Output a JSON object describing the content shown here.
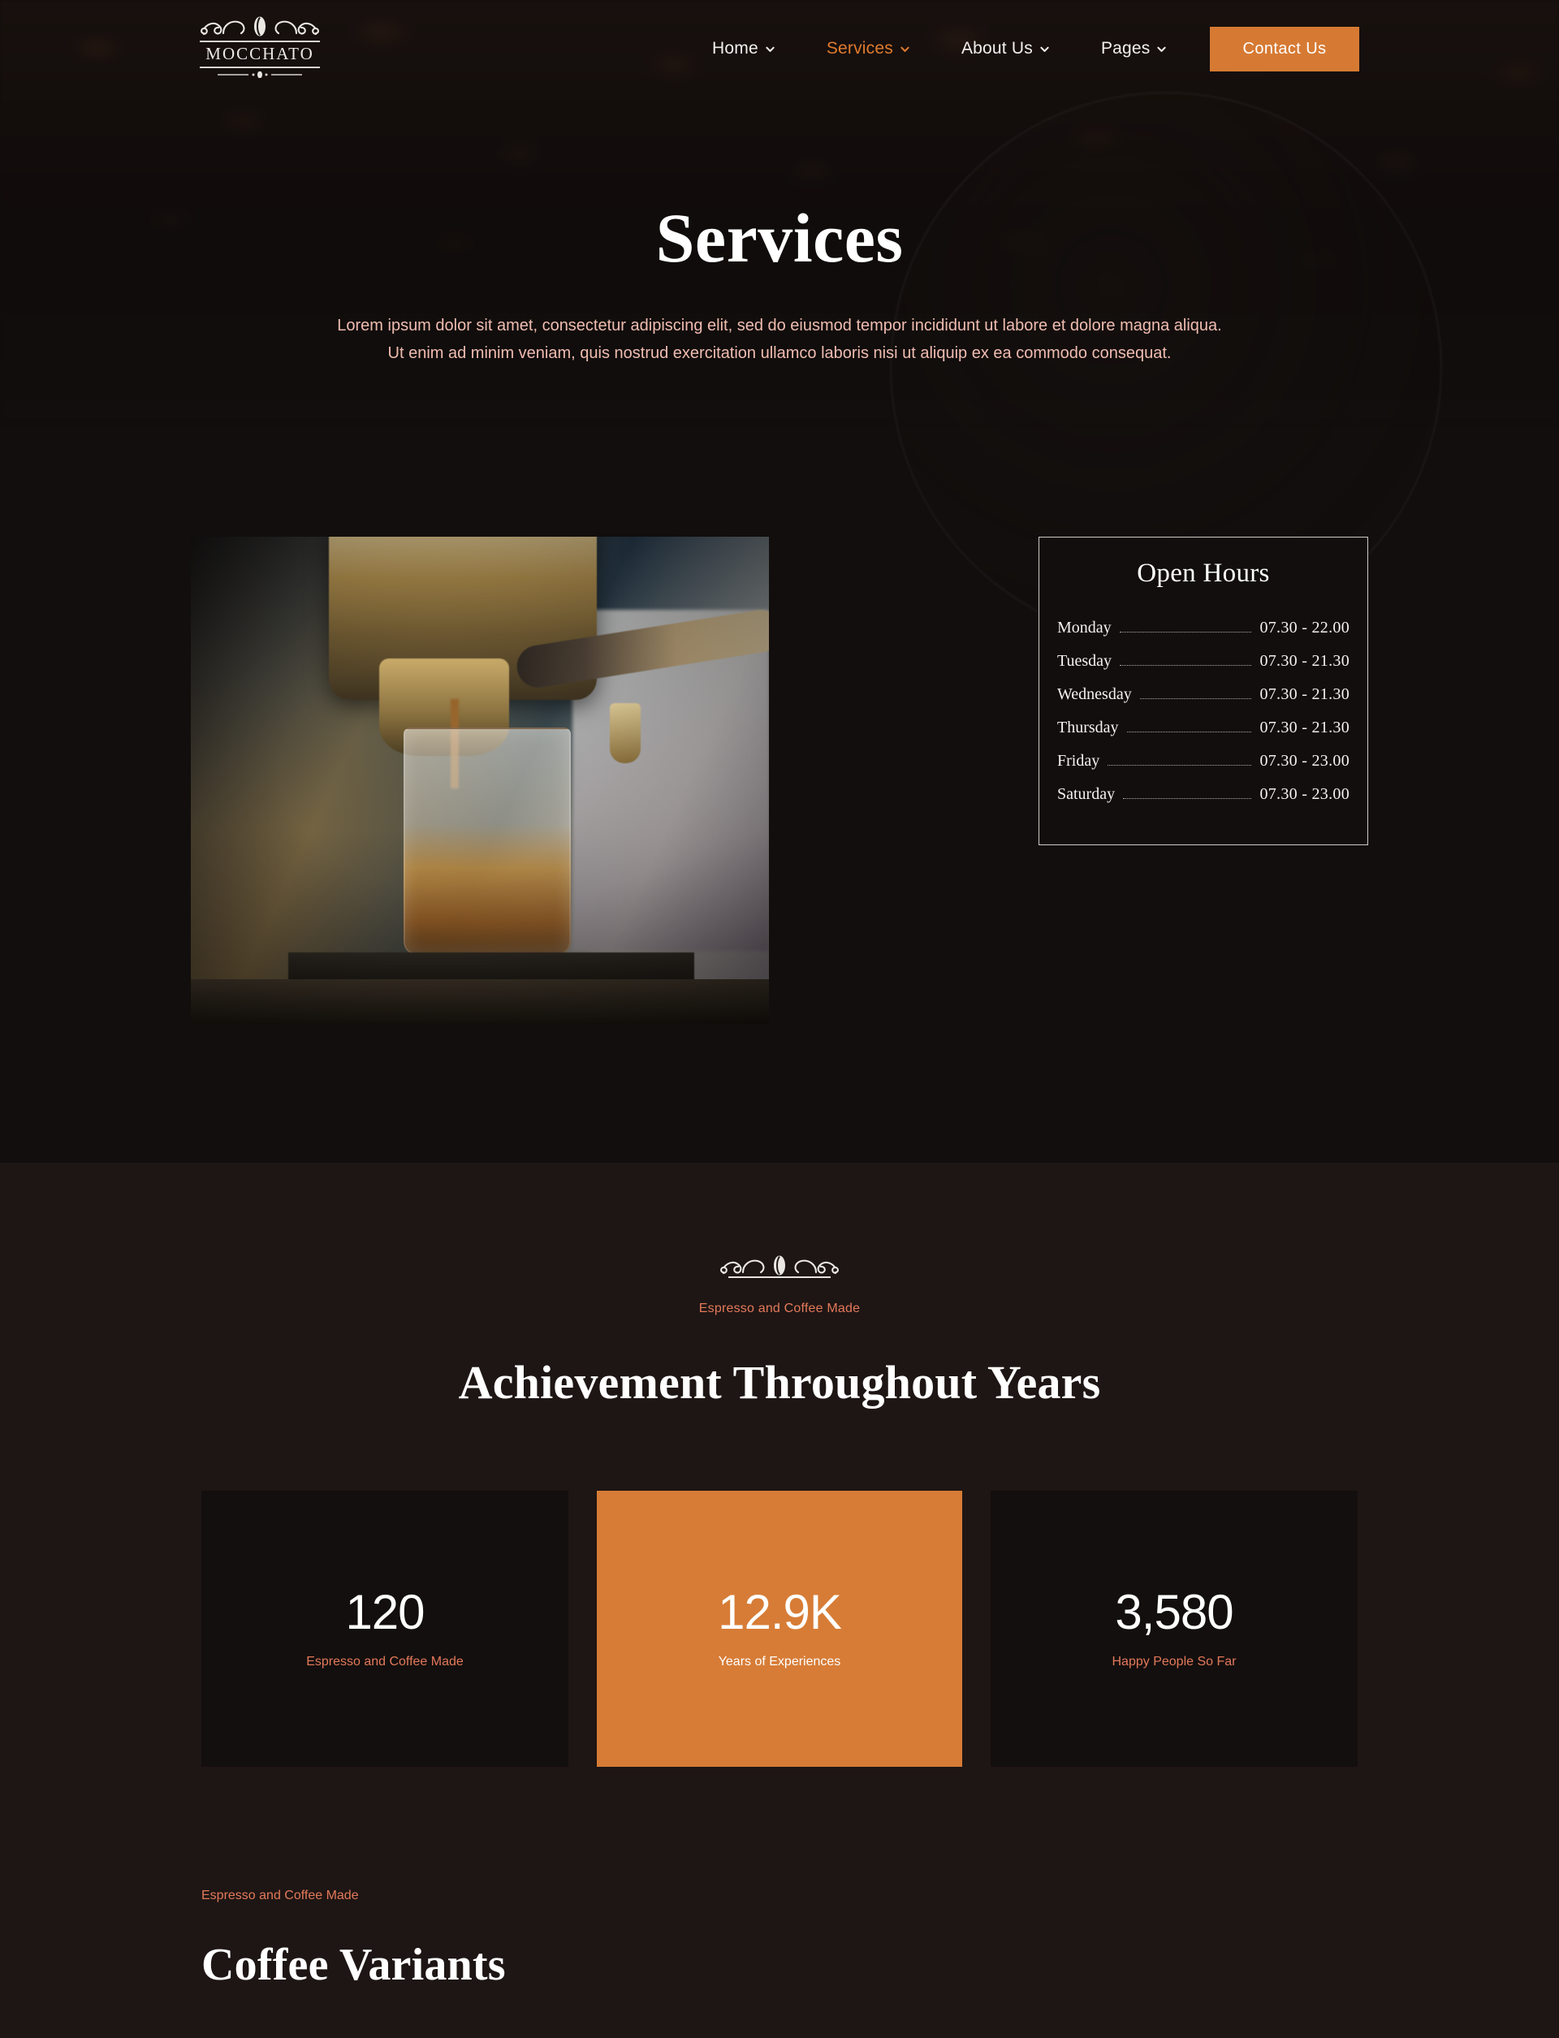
{
  "brand": {
    "name": "MOCCHATO",
    "logo_icon": "coffee-bean-ornament-icon"
  },
  "nav": {
    "items": [
      {
        "label": "Home",
        "has_dropdown": true,
        "active": false
      },
      {
        "label": "Services",
        "has_dropdown": true,
        "active": true
      },
      {
        "label": "About Us",
        "has_dropdown": true,
        "active": false
      },
      {
        "label": "Pages",
        "has_dropdown": true,
        "active": false
      }
    ],
    "cta_label": "Contact Us"
  },
  "hero": {
    "title": "Services",
    "subtitle_line1": "Lorem ipsum dolor sit amet, consectetur adipiscing elit, sed do eiusmod tempor incididunt ut labore et dolore magna aliqua.",
    "subtitle_line2": "Ut enim ad minim veniam, quis nostrud exercitation ullamco laboris nisi ut aliquip ex ea commodo consequat."
  },
  "services": {
    "photo_alt": "espresso-machine-pouring-coffee",
    "hours": {
      "title": "Open Hours",
      "rows": [
        {
          "day": "Monday",
          "time": "07.30 - 22.00"
        },
        {
          "day": "Tuesday",
          "time": "07.30 - 21.30"
        },
        {
          "day": "Wednesday",
          "time": "07.30 - 21.30"
        },
        {
          "day": "Thursday",
          "time": "07.30 - 21.30"
        },
        {
          "day": "Friday",
          "time": "07.30 - 23.00"
        },
        {
          "day": "Saturday",
          "time": "07.30 - 23.00"
        }
      ]
    }
  },
  "achievement": {
    "eyebrow": "Espresso and Coffee Made",
    "title": "Achievement Throughout Years",
    "stats": [
      {
        "value": "120",
        "caption": "Espresso and Coffee Made",
        "accent": false
      },
      {
        "value": "12.9K",
        "caption": "Years of Experiences",
        "accent": true
      },
      {
        "value": "3,580",
        "caption": "Happy People So Far",
        "accent": false
      }
    ]
  },
  "variants": {
    "eyebrow": "Espresso and Coffee Made",
    "title": "Coffee Variants"
  },
  "colors": {
    "accent_orange": "#D77C36",
    "nav_active": "#E07B2E",
    "eyebrow_orange": "#E3795A",
    "hero_subtitle": "#F0BCB0",
    "bg_dark": "#110E0D",
    "bg_brown": "#1E1614"
  }
}
